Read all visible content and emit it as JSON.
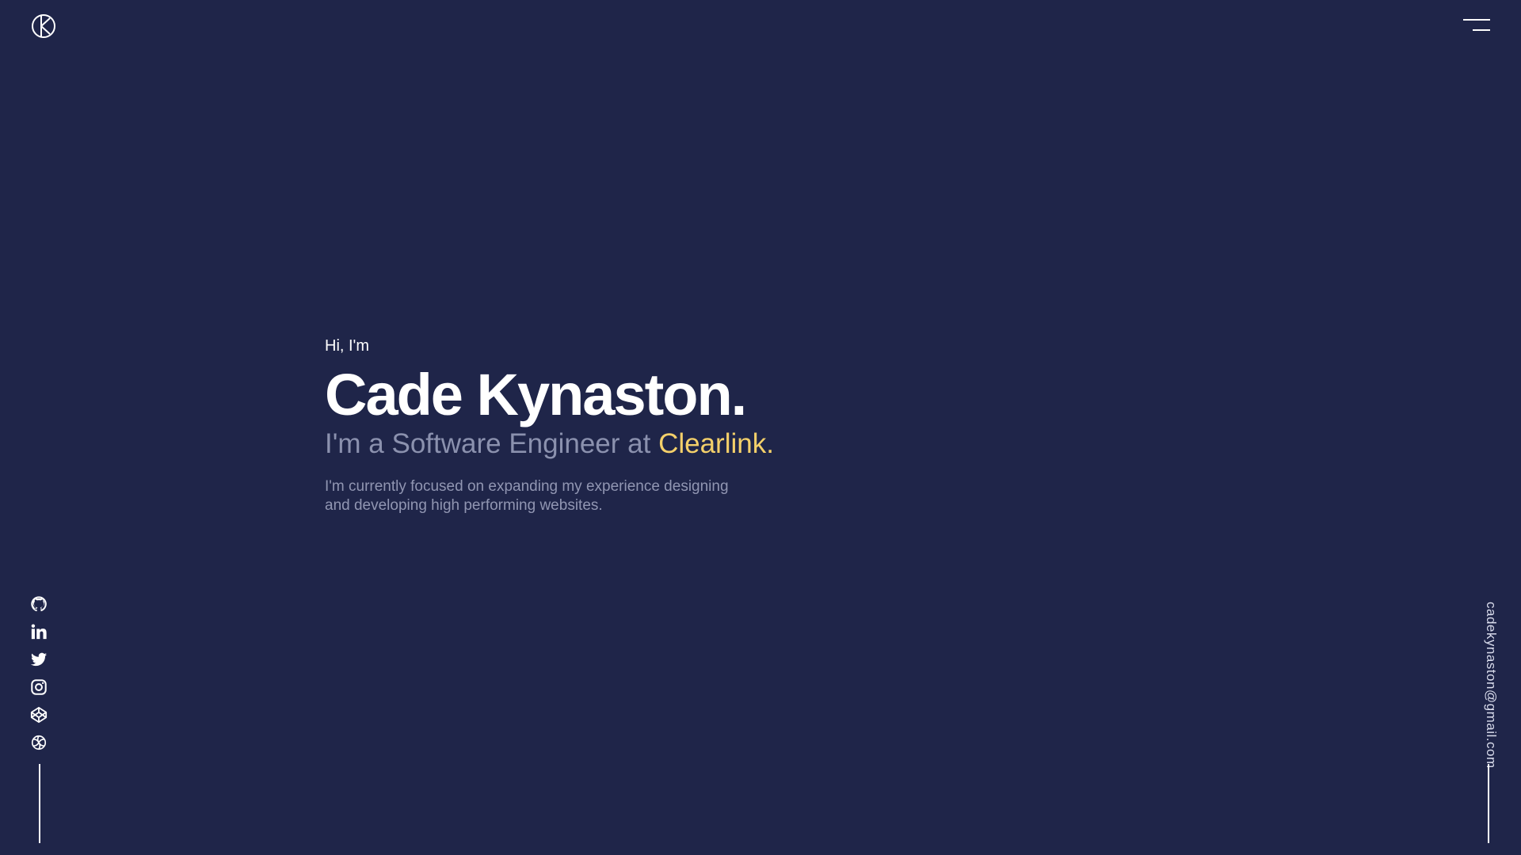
{
  "header": {
    "logo_icon": "ck-logo-icon",
    "menu_icon": "hamburger-menu-icon"
  },
  "hero": {
    "greeting": "Hi, I'm",
    "name": "Cade Kynaston.",
    "role_prefix": "I'm a Software Engineer at ",
    "company": "Clearlink.",
    "description": "I'm currently focused on expanding my experience designing and developing high performing websites."
  },
  "social": {
    "icons": [
      "github-icon",
      "linkedin-icon",
      "twitter-icon",
      "instagram-icon",
      "codepen-icon",
      "openai-icon"
    ]
  },
  "contact": {
    "email": "cadekynaston@gmail.com"
  },
  "colors": {
    "background": "#1f2549",
    "accent": "#f4d06a",
    "muted_text": "#8b91ae",
    "primary_text": "#ffffff"
  }
}
